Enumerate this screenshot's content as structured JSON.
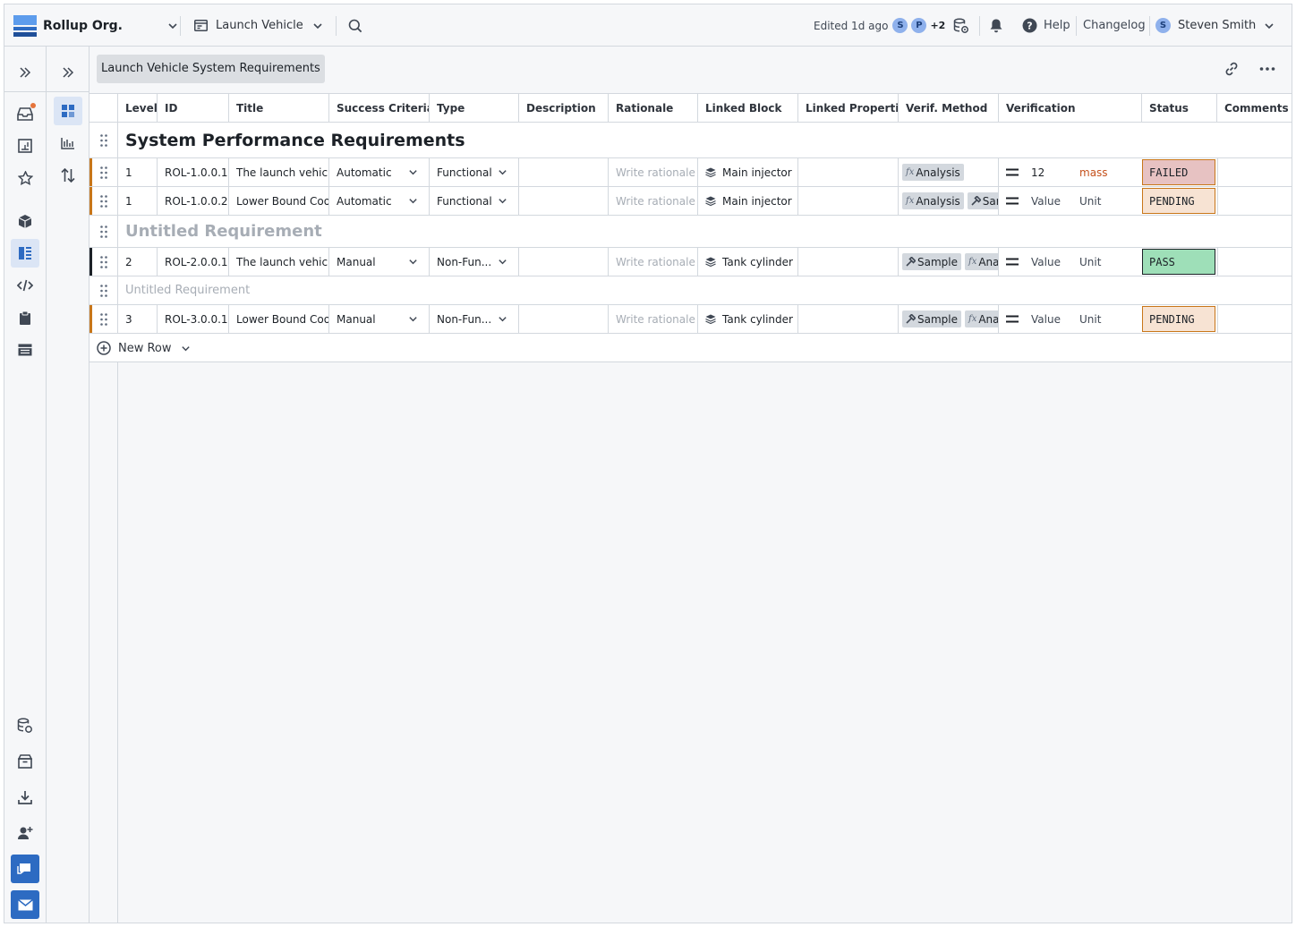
{
  "topbar": {
    "org_name": "Rollup Org.",
    "workspace": "Launch Vehicle",
    "edited": "Edited 1d ago",
    "collaborators": [
      "S",
      "P"
    ],
    "collaborators_more": "+2",
    "help": "Help",
    "changelog": "Changelog",
    "user_initial": "S",
    "user_name": "Steven Smith"
  },
  "document": {
    "title": "Launch Vehicle System Requirements"
  },
  "columns": [
    "Level",
    "ID",
    "Title",
    "Success Criteria",
    "Type",
    "Description",
    "Rationale",
    "Linked Block",
    "Linked Properties",
    "Verif. Method",
    "Verification",
    "Status",
    "Comments"
  ],
  "sections": {
    "s1": "System Performance Requirements",
    "s2": "Untitled Requirement",
    "s3": "Untitled Requirement"
  },
  "rows": [
    {
      "level": "1",
      "id": "ROL-1.0.0.1.",
      "title": "The launch vehicle",
      "criteria": "Automatic",
      "type": "Functional",
      "rationale": "Write rationale",
      "block": "Main injector",
      "methods": [
        "Analysis"
      ],
      "value": "12",
      "unit": "mass",
      "status": "FAILED"
    },
    {
      "level": "1",
      "id": "ROL-1.0.0.2.",
      "title": "Lower Bound Coolir",
      "criteria": "Automatic",
      "type": "Functional",
      "rationale": "Write rationale",
      "block": "Main injector",
      "methods": [
        "Analysis",
        "San"
      ],
      "value": "Value",
      "unit": "Unit",
      "status": "PENDING"
    },
    {
      "level": "2",
      "id": "ROL-2.0.0.1.",
      "title": "The launch vehicle",
      "criteria": "Manual",
      "type": "Non-Fun...",
      "rationale": "Write rationale",
      "block": "Tank cylinder",
      "methods": [
        "Sample",
        "Analy"
      ],
      "value": "Value",
      "unit": "Unit",
      "status": "PASS"
    },
    {
      "level": "3",
      "id": "ROL-3.0.0.1.",
      "title": "Lower Bound Coolir",
      "criteria": "Manual",
      "type": "Non-Fun...",
      "rationale": "Write rationale",
      "block": "Tank cylinder",
      "methods": [
        "Sample",
        "Analy"
      ],
      "value": "Value",
      "unit": "Unit",
      "status": "PENDING"
    }
  ],
  "new_row": "New Row",
  "colors": {
    "accent": "#2d6bc2",
    "failed_bg": "#e7c2c2",
    "pending_bg": "#f7e3d3",
    "pass_bg": "#9edfb8",
    "row_accent": "#c87619"
  }
}
